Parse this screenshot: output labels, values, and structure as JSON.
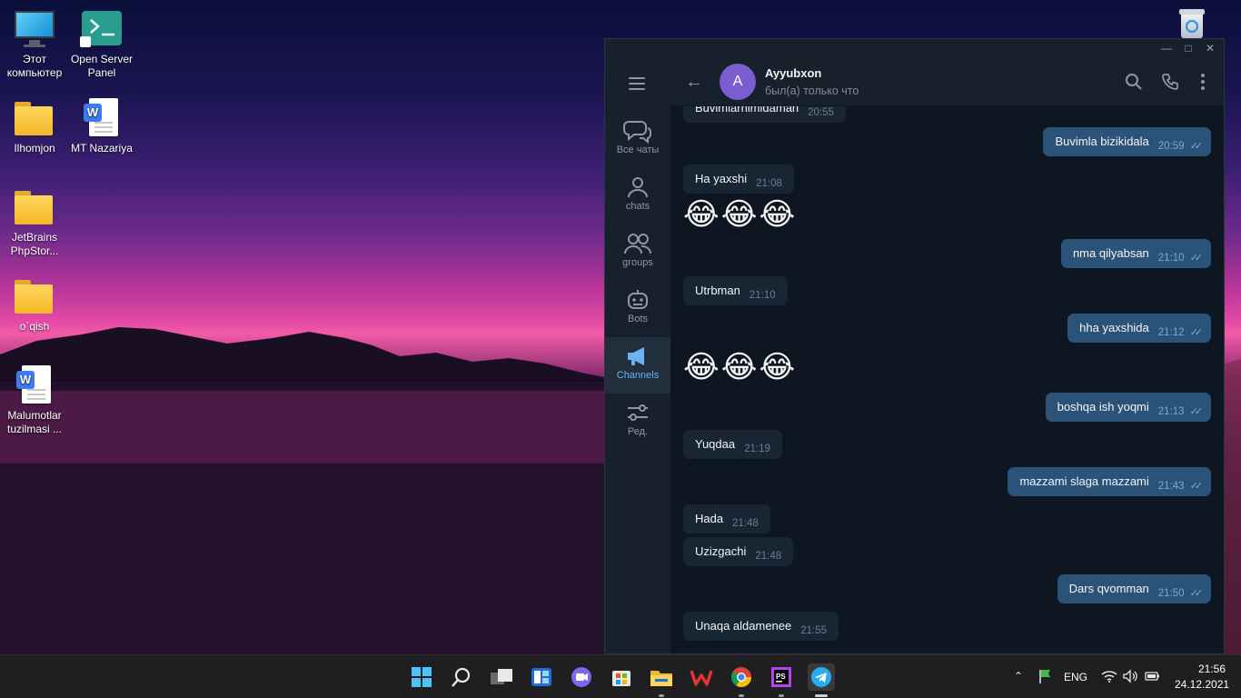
{
  "desktop": {
    "icons": [
      {
        "label": "Этот компьютер"
      },
      {
        "label": "Open Server Panel"
      },
      {
        "label": "Ilhomjon"
      },
      {
        "label": "MT Nazariya"
      },
      {
        "label": "JetBrains PhpStor..."
      },
      {
        "label": "o`qish"
      },
      {
        "label": "Malumotlar tuzilmasi ..."
      }
    ]
  },
  "telegram": {
    "header": {
      "avatar_letter": "A",
      "name": "Ayyubxon",
      "status": "был(а) только что"
    },
    "folders": [
      {
        "label": "Все чаты",
        "icon": "chat-bubbles-icon"
      },
      {
        "label": "chats",
        "icon": "person-icon"
      },
      {
        "label": "groups",
        "icon": "people-icon"
      },
      {
        "label": "Bots",
        "icon": "robot-icon"
      },
      {
        "label": "Channels",
        "icon": "megaphone-icon"
      },
      {
        "label": "Ред.",
        "icon": "sliders-icon"
      }
    ],
    "messages": [
      {
        "dir": "in",
        "text": "Buvimlarnimidaman",
        "time": "20:55"
      },
      {
        "dir": "out",
        "text": "Buvimla bizikidala",
        "time": "20:59"
      },
      {
        "dir": "in",
        "text": "Ha yaxshi",
        "time": "21:08"
      },
      {
        "dir": "in-emoji",
        "text": "😂😂😂"
      },
      {
        "dir": "out",
        "text": "nma qilyabsan",
        "time": "21:10"
      },
      {
        "dir": "in",
        "text": "Utrbman",
        "time": "21:10"
      },
      {
        "dir": "out",
        "text": "hha yaxshida",
        "time": "21:12"
      },
      {
        "dir": "in-emoji",
        "text": "😂😂😂"
      },
      {
        "dir": "out",
        "text": "boshqa ish yoqmi",
        "time": "21:13"
      },
      {
        "dir": "in",
        "text": "Yuqdaa",
        "time": "21:19"
      },
      {
        "dir": "out",
        "text": "mazzami slaga mazzami",
        "time": "21:43"
      },
      {
        "dir": "in",
        "text": "Hada",
        "time": "21:48"
      },
      {
        "dir": "in",
        "text": "Uzizgachi",
        "time": "21:48"
      },
      {
        "dir": "out",
        "text": "Dars qvomman",
        "time": "21:50"
      },
      {
        "dir": "in",
        "text": "Unaqa aldamenee",
        "time": "21:55"
      }
    ]
  },
  "taskbar": {
    "language": "ENG",
    "time": "21:56",
    "date": "24.12.2021"
  },
  "colors": {
    "tg_bg": "#17212b",
    "tg_chat_bg": "#0e1621",
    "bubble_in": "#182533",
    "bubble_out": "#2b5278",
    "accent": "#6ab2f2"
  }
}
